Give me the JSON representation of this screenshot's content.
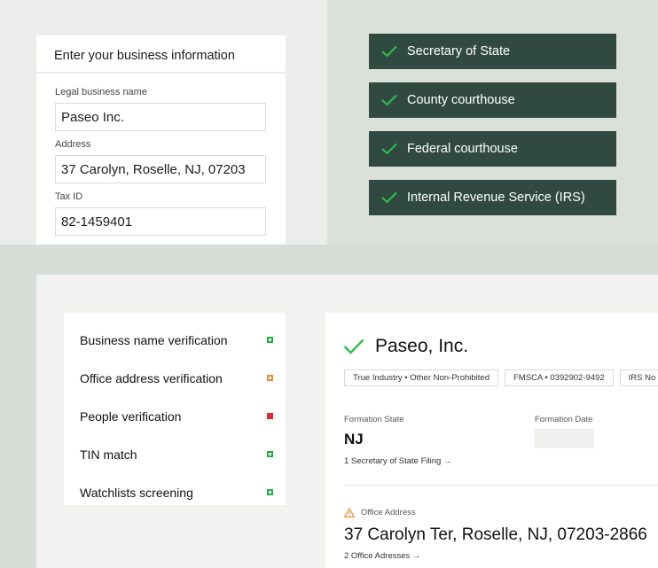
{
  "form": {
    "title": "Enter your business information",
    "fields": [
      {
        "label": "Legal business name",
        "value": "Paseo Inc."
      },
      {
        "label": "Address",
        "value": "37 Carolyn, Roselle, NJ, 07203"
      },
      {
        "label": "Tax ID",
        "value": "82-1459401"
      }
    ]
  },
  "sources": [
    {
      "label": "Secretary of State"
    },
    {
      "label": "County courthouse"
    },
    {
      "label": "Federal courthouse"
    },
    {
      "label": "Internal Revenue Service (IRS)"
    }
  ],
  "checklist": [
    {
      "label": "Business name verification",
      "status": "green"
    },
    {
      "label": "Office address verification",
      "status": "orange"
    },
    {
      "label": "People verification",
      "status": "red"
    },
    {
      "label": "TIN match",
      "status": "green"
    },
    {
      "label": "Watchlists screening",
      "status": "green"
    }
  ],
  "result": {
    "name": "Paseo, Inc.",
    "tags": [
      "True Industry • Other Non-Prohibited",
      "FMSCA • 0392902-9492",
      "IRS No"
    ],
    "formation_state_label": "Formation State",
    "formation_state_value": "NJ",
    "formation_date_label": "Formation Date",
    "sos_link": "1 Secretary of State Filing →",
    "office_address_label": "Office Address",
    "office_address_value": "37 Carolyn Ter, Roselle, NJ, 07203-2866",
    "address_link": "2 Office Adresses →"
  },
  "colors": {
    "source_bg": "#304a42",
    "check_green": "#2ec04a",
    "status_green": "#1fb23a",
    "status_orange": "#f08a25",
    "status_red": "#e8262d"
  }
}
